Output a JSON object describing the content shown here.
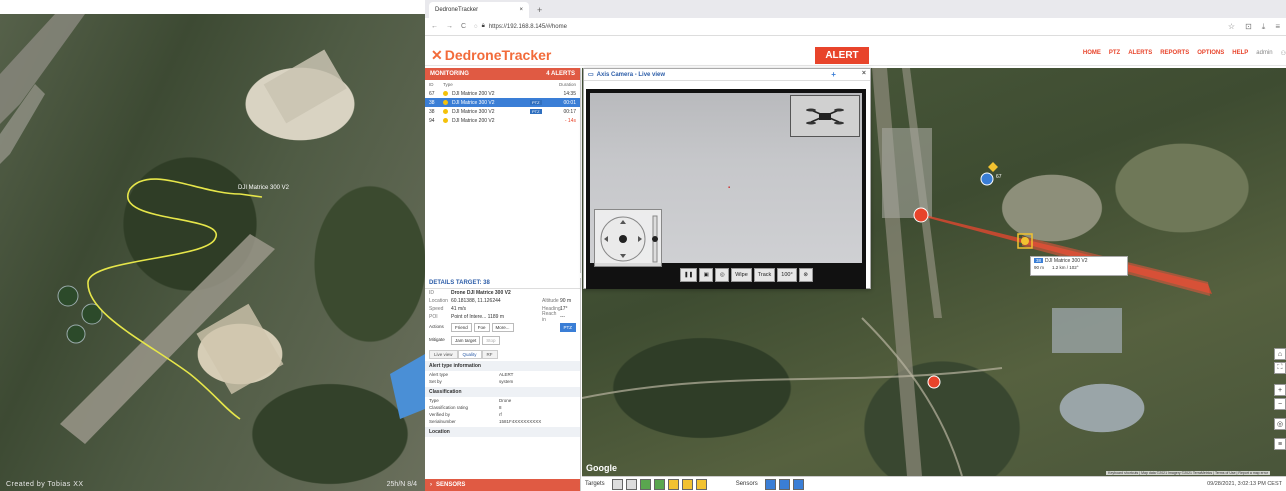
{
  "left_photo": {
    "caption": "Created by Tobias XX",
    "drone_label": "DJI Matrice 300 V2",
    "credit": "25h/N 8/4"
  },
  "browser": {
    "tab_title": "DedroneTracker",
    "tab_close": "×",
    "new_tab": "+",
    "url": "https://192.168.8.145/#/home",
    "nav_back": "←",
    "nav_forward": "→",
    "nav_reload": "C"
  },
  "app": {
    "logo_text": "DedroneTracker",
    "alert_button": "ALERT",
    "nav_items": [
      "HOME",
      "PTZ",
      "ALERTS",
      "REPORTS",
      "OPTIONS",
      "HELP"
    ],
    "user": "admin"
  },
  "monitoring": {
    "title": "MONITORING",
    "alert_count": "4 ALERTS",
    "col_id": "ID",
    "col_type": "Type",
    "col_duration": "Duration",
    "rows": [
      {
        "id": "67",
        "type": "DJI Matrice 200 V2",
        "badge": "",
        "duration": "14:35"
      },
      {
        "id": "38",
        "type": "DJI Matrice 300 V2",
        "badge": "PTZ",
        "duration": "00:01"
      },
      {
        "id": "38",
        "type": "DJI Matrice 300 V2",
        "badge": "PTZ",
        "duration": "00:17"
      },
      {
        "id": "94",
        "type": "DJI Matrice 200 V2",
        "badge": "",
        "duration": "- 14s"
      }
    ]
  },
  "details": {
    "title": "DETAILS TARGET: 38",
    "id_label": "ID",
    "id_value": "Drone DJI Matrice 300 V2",
    "location_label": "Location",
    "location_value": "60.181388, 11.126244",
    "altitude_label": "Altitude",
    "altitude_value": "90 m",
    "speed_label": "Speed",
    "speed_value": "41 m/s",
    "heading_label": "Heading",
    "heading_value": "17°",
    "poi_label": "POI",
    "poi_value": "Point of Intere... 1189 m",
    "reach_label": "Reach in",
    "reach_value": "---",
    "actions_label": "Actions",
    "actions": [
      "Friend",
      "Foe",
      "More..."
    ],
    "ptz_button": "PTZ",
    "mitigate_label": "Mitigate",
    "mitigate_actions": [
      "Jam target",
      "Stop"
    ],
    "subtabs": [
      "Live view",
      "Quality",
      "RF"
    ],
    "alert_section": "Alert type information",
    "alert_rows": [
      {
        "k": "Alert type",
        "v": "ALERT"
      },
      {
        "k": "Set by",
        "v": "system"
      }
    ],
    "class_section": "Classification",
    "class_rows": [
      {
        "k": "Type",
        "v": "Drone"
      },
      {
        "k": "Classification rating",
        "v": "8"
      },
      {
        "k": "Verified by",
        "v": "rf"
      },
      {
        "k": "Serialnumber",
        "v": "1581F4XXXXXXXXX"
      }
    ],
    "location_section": "Location",
    "sensors_bar": "SENSORS"
  },
  "camera": {
    "title": "Axis Camera - Live view",
    "toolbar": [
      "❚❚",
      "▣",
      "◎",
      "Wipe",
      "Track",
      "100°",
      "⊗"
    ]
  },
  "map": {
    "google": "Google",
    "attribution": "Keyboard shortcuts | Map data ©2021 Imagery ©2021 TerraMetrics | Terms of Use | Report a map error",
    "tooltip_id": "38",
    "tooltip_name": "DJI Matrice 300 V2",
    "tooltip_alt": "90 m",
    "tooltip_dist": "1.2 km / 102°",
    "marker_label": "67",
    "controls": [
      "⌂",
      "⛶",
      "+",
      "−",
      "◎",
      "≡"
    ]
  },
  "bottombar": {
    "targets_label": "Targets",
    "sensors_label": "Sensors",
    "datetime": "09/28/2021, 3:02:13 PM CEST"
  },
  "colors": {
    "accent": "#e8442b",
    "brand": "#f26b3a",
    "selection": "#3a7ed6",
    "drone_track": "#e5e54a"
  }
}
